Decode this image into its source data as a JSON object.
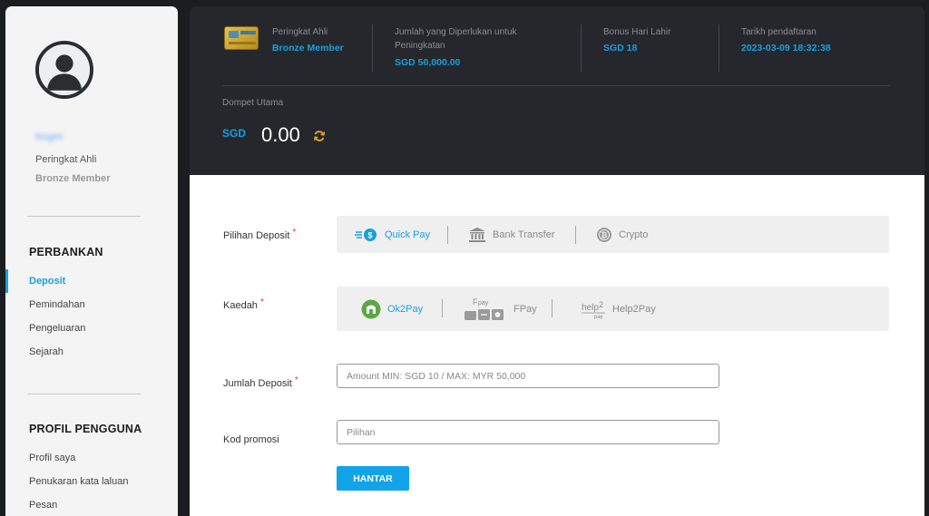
{
  "sidebar": {
    "username": "bogm",
    "rank_label": "Peringkat Ahli",
    "rank_value": "Bronze Member",
    "banking": {
      "title": "PERBANKAN",
      "items": [
        "Deposit",
        "Pemindahan",
        "Pengeluaran",
        "Sejarah"
      ]
    },
    "profile": {
      "title": "PROFIL PENGGUNA",
      "items": [
        "Profil saya",
        "Penukaran kata laluan",
        "Pesan"
      ]
    }
  },
  "header": {
    "rank_label": "Peringkat Ahli",
    "rank_value": "Bronze Member",
    "required_label_line1": "Jumlah yang Diperlukan untuk",
    "required_label_line2": "Peningkatan",
    "required_value": "SGD 50,000.00",
    "birthday_label": "Bonus Hari Lahir",
    "birthday_value": "SGD 18",
    "register_label": "Tarikh pendaftaran",
    "register_value": "2023-03-09 18:32:38",
    "wallet_label": "Dompet Utama",
    "wallet_currency": "SGD",
    "wallet_amount": "0.00"
  },
  "form": {
    "deposit_option_label": "Pilihan Deposit",
    "deposit_options": [
      "Quick Pay",
      "Bank Transfer",
      "Crypto"
    ],
    "selected_option": "Quick Pay",
    "method_label": "Kaedah",
    "methods": [
      "Ok2Pay",
      "FPay",
      "Help2Pay"
    ],
    "amount_label": "Jumlah Deposit",
    "amount_placeholder": "Amount MIN: SGD 10 / MAX: MYR 50,000",
    "promo_label": "Kod promosi",
    "promo_placeholder": "Pilihan",
    "submit_label": "HANTAR",
    "required_mark": "*"
  },
  "colors": {
    "accent": "#1a9fe0",
    "header_bg": "#25272c",
    "page_bg": "#1b1d21",
    "sidebar_bg": "#f4f4f4",
    "refresh_icon": "#e0a030",
    "ok2pay_green": "#5aa845"
  },
  "icons": {
    "avatar": "user-avatar-icon",
    "member_card": "member-card-icon",
    "refresh": "refresh-icon",
    "quick_pay": "quick-pay-coin-icon",
    "bank_transfer": "bank-icon",
    "crypto": "crypto-coin-icon",
    "ok2pay": "ok2pay-logo",
    "fpay": "fpay-logo",
    "help2pay": "help2pay-logo"
  }
}
